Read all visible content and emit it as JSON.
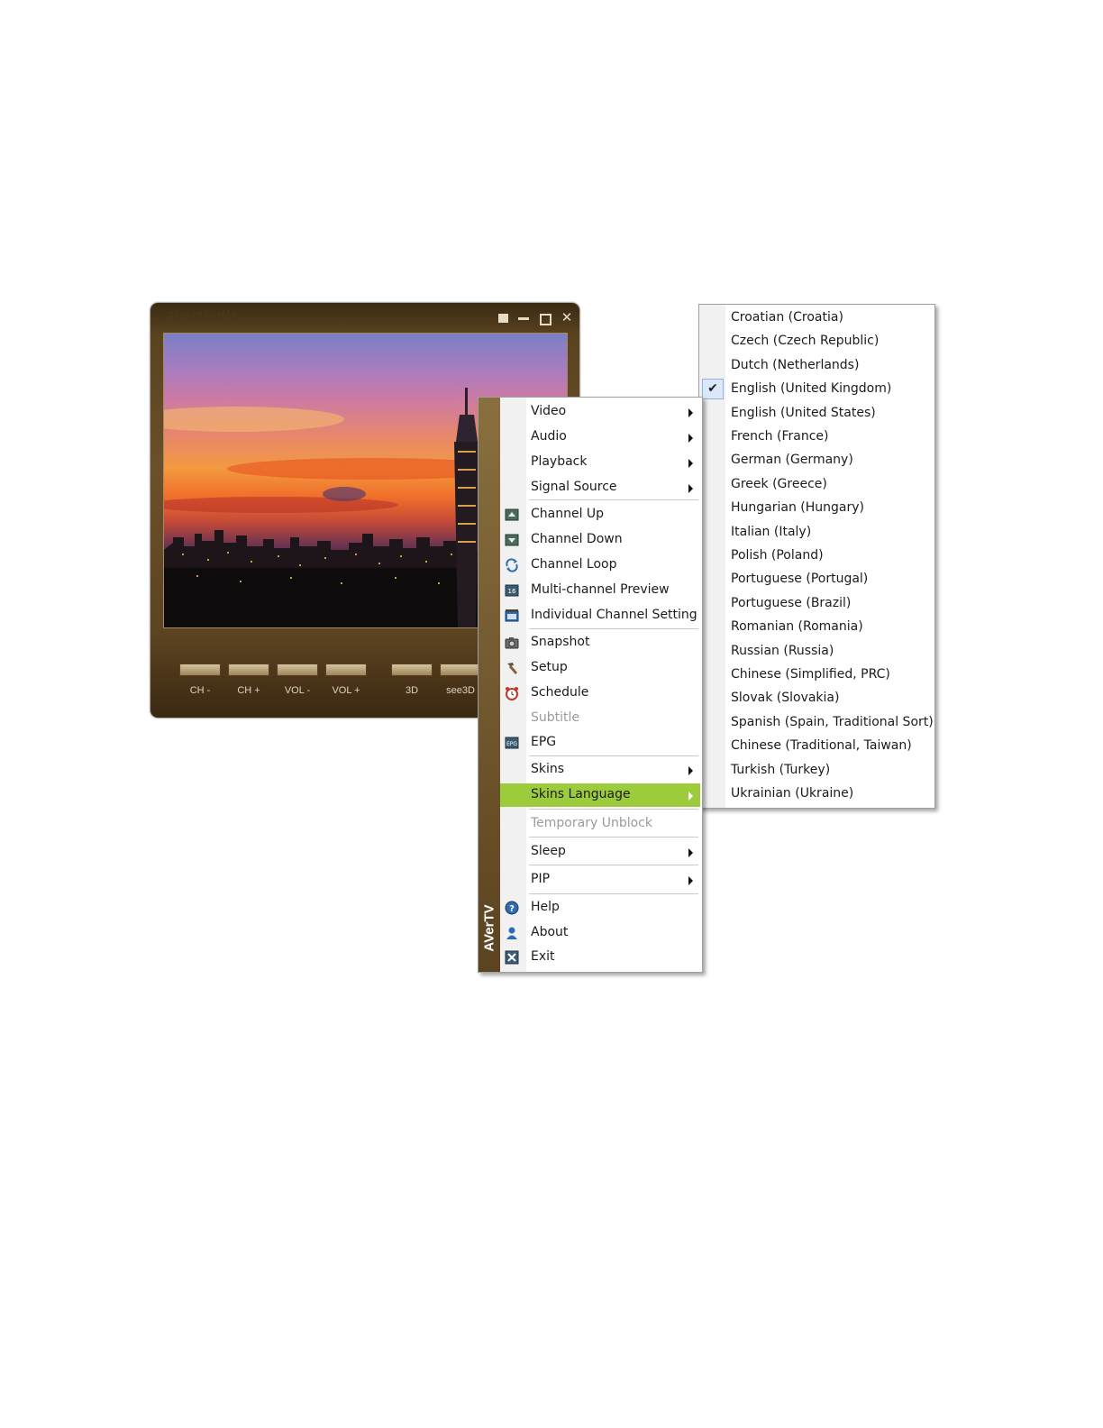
{
  "player": {
    "brand": "AVerMedia",
    "window_controls": [
      "restore-icon",
      "minimize-icon",
      "maximize-icon",
      "close-icon"
    ],
    "buttons": [
      {
        "label": "CH -"
      },
      {
        "label": "CH +"
      },
      {
        "label": "VOL -"
      },
      {
        "label": "VOL +"
      },
      {
        "label": "3D"
      },
      {
        "label": "see3D"
      }
    ]
  },
  "menu": {
    "side_label": "AVerTV",
    "accent_color": "#9ccc3c",
    "items": [
      {
        "label": "Video",
        "submenu": true
      },
      {
        "label": "Audio",
        "submenu": true
      },
      {
        "label": "Playback",
        "submenu": true
      },
      {
        "label": "Signal Source",
        "submenu": true
      },
      {
        "label": "Channel Up",
        "icon": "channel-up-icon"
      },
      {
        "label": "Channel Down",
        "icon": "channel-down-icon"
      },
      {
        "label": "Channel Loop",
        "icon": "loop-icon"
      },
      {
        "label": "Multi-channel Preview",
        "icon": "multi-channel-icon"
      },
      {
        "label": "Individual Channel Setting",
        "icon": "channel-setting-icon"
      },
      {
        "label": "Snapshot",
        "icon": "camera-icon"
      },
      {
        "label": "Setup",
        "icon": "hammer-icon"
      },
      {
        "label": "Schedule",
        "icon": "alarm-clock-icon"
      },
      {
        "label": "Subtitle",
        "disabled": true
      },
      {
        "label": "EPG",
        "icon": "epg-icon"
      },
      {
        "label": "Skins",
        "submenu": true
      },
      {
        "label": "Skins Language",
        "submenu": true,
        "highlighted": true
      },
      {
        "label": "Temporary Unblock",
        "disabled": true
      },
      {
        "label": "Sleep",
        "submenu": true
      },
      {
        "label": "PIP",
        "submenu": true
      },
      {
        "label": "Help",
        "icon": "help-icon"
      },
      {
        "label": "About",
        "icon": "user-icon"
      },
      {
        "label": "Exit",
        "icon": "exit-icon"
      }
    ]
  },
  "submenu": {
    "items": [
      {
        "label": "Croatian (Croatia)"
      },
      {
        "label": "Czech (Czech Republic)"
      },
      {
        "label": "Dutch (Netherlands)"
      },
      {
        "label": "English (United Kingdom)",
        "checked": true
      },
      {
        "label": "English (United States)"
      },
      {
        "label": "French (France)"
      },
      {
        "label": "German (Germany)"
      },
      {
        "label": "Greek (Greece)"
      },
      {
        "label": "Hungarian (Hungary)"
      },
      {
        "label": "Italian (Italy)"
      },
      {
        "label": "Polish (Poland)"
      },
      {
        "label": "Portuguese (Portugal)"
      },
      {
        "label": "Portuguese (Brazil)"
      },
      {
        "label": "Romanian (Romania)"
      },
      {
        "label": "Russian (Russia)"
      },
      {
        "label": "Chinese (Simplified, PRC)"
      },
      {
        "label": "Slovak (Slovakia)"
      },
      {
        "label": "Spanish (Spain, Traditional Sort)"
      },
      {
        "label": "Chinese (Traditional, Taiwan)"
      },
      {
        "label": "Turkish (Turkey)"
      },
      {
        "label": "Ukrainian (Ukraine)"
      }
    ]
  }
}
